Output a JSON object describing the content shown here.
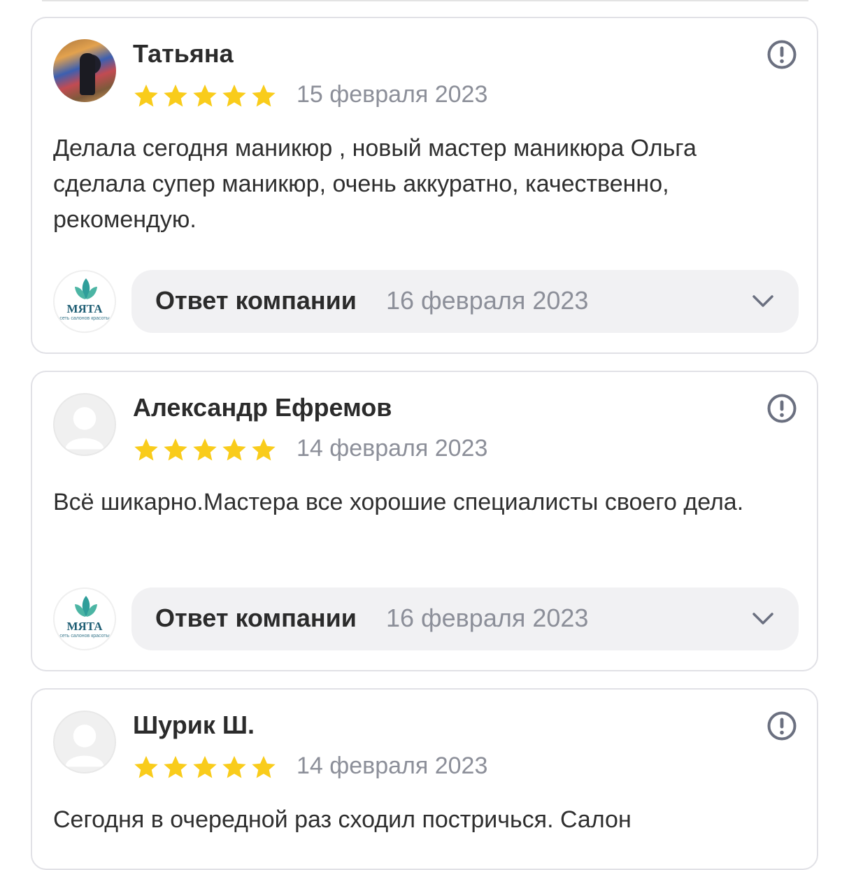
{
  "reviews": [
    {
      "author": "Татьяна",
      "avatar": "user-photo",
      "rating": 5,
      "date": "15 февраля 2023",
      "text": "Делала сегодня маникюр , новый мастер маникюра Ольга сделала супер маникюр, очень аккуратно, качественно, рекомендую.",
      "reply": {
        "label": "Ответ компании",
        "date": "16 февраля 2023"
      }
    },
    {
      "author": "Александр Ефремов",
      "avatar": "default-user-icon",
      "rating": 5,
      "date": "14 февраля 2023",
      "text": "Всё шикарно.Мастера все хорошие специалисты своего дела.",
      "reply": {
        "label": "Ответ компании",
        "date": "16 февраля 2023"
      }
    },
    {
      "author": "Шурик Ш.",
      "avatar": "default-user-icon",
      "rating": 5,
      "date": "14 февраля 2023",
      "text": "Сегодня в очередной раз сходил постричься. Салон"
    }
  ],
  "company_logo": {
    "brand": "МЯТА",
    "tagline": "сеть салонов красоты"
  },
  "colors": {
    "star": "#f9cc1b",
    "date": "#8c8f99",
    "reply_bg": "#f1f1f3",
    "border": "#e1e1e6",
    "logo_leaf": "#2f9e9a",
    "logo_text": "#1f5e74"
  }
}
